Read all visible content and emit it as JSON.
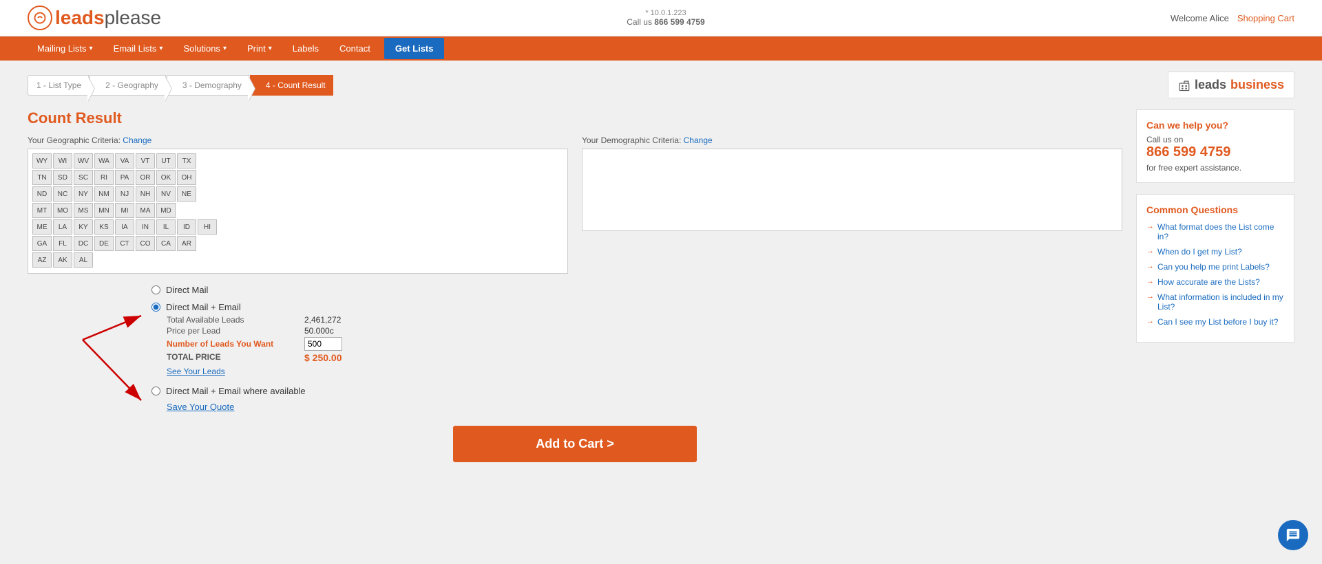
{
  "header": {
    "ip": "* 10.0.1.223",
    "call_label": "Call us",
    "phone": "866 599 4759",
    "welcome": "Welcome Alice",
    "shopping_cart": "Shopping Cart",
    "logo_leads": "leads",
    "logo_please": "please"
  },
  "nav": {
    "items": [
      {
        "label": "Mailing Lists",
        "dropdown": true
      },
      {
        "label": "Email Lists",
        "dropdown": true
      },
      {
        "label": "Solutions",
        "dropdown": true
      },
      {
        "label": "Print",
        "dropdown": true
      },
      {
        "label": "Labels",
        "dropdown": false
      },
      {
        "label": "Contact",
        "dropdown": false
      }
    ],
    "get_lists": "Get Lists"
  },
  "breadcrumb": {
    "steps": [
      {
        "label": "1 - List Type",
        "active": false
      },
      {
        "label": "2 - Geography",
        "active": false
      },
      {
        "label": "3 - Demography",
        "active": false
      },
      {
        "label": "4 - Count Result",
        "active": true
      }
    ]
  },
  "leads_business": {
    "icon": "🏢",
    "text_dark": "leads",
    "text_orange": "business"
  },
  "page_title": "Count Result",
  "geo_criteria": {
    "label": "Your Geographic Criteria:",
    "change_link": "Change"
  },
  "demo_criteria": {
    "label": "Your Demographic Criteria:",
    "change_link": "Change"
  },
  "states": [
    [
      "WY",
      "WI",
      "WV",
      "WA",
      "VA",
      "VT",
      "UT",
      "TX"
    ],
    [
      "TN",
      "SD",
      "SC",
      "RI",
      "PA",
      "OR",
      "OK",
      "OH"
    ],
    [
      "ND",
      "NC",
      "NY",
      "NM",
      "NJ",
      "NH",
      "NV",
      "NE"
    ],
    [
      "MT",
      "MO",
      "MS",
      "MN",
      "MI",
      "MA",
      "MD"
    ],
    [
      "ME",
      "LA",
      "KY",
      "KS",
      "IA",
      "IN",
      "IL",
      "ID",
      "HI"
    ],
    [
      "GA",
      "FL",
      "DC",
      "DE",
      "CT",
      "CO",
      "CA",
      "AR"
    ],
    [
      "AZ",
      "AK",
      "AL"
    ]
  ],
  "options": {
    "direct_mail": {
      "label": "Direct Mail",
      "selected": false
    },
    "direct_mail_email": {
      "label": "Direct Mail + Email",
      "selected": true,
      "details": {
        "total_leads_label": "Total Available Leads",
        "total_leads_value": "2,461,272",
        "price_per_lead_label": "Price per Lead",
        "price_per_lead_value": "50.000c",
        "num_leads_label": "Number of Leads You Want",
        "num_leads_value": "500",
        "total_price_label": "TOTAL PRICE",
        "total_price_value": "$ 250.00",
        "see_leads_link": "See Your Leads"
      }
    },
    "direct_mail_email_avail": {
      "label": "Direct Mail + Email where available",
      "selected": false
    }
  },
  "save_quote": "Save Your Quote",
  "add_to_cart": "Add to Cart >",
  "sidebar": {
    "help": {
      "title": "Can we help you?",
      "call_label": "Call us on",
      "phone": "866 599 4759",
      "subtitle": "for free expert assistance."
    },
    "faq": {
      "title": "Common Questions",
      "items": [
        "What format does the List come in?",
        "When do I get my List?",
        "Can you help me print Labels?",
        "How accurate are the Lists?",
        "What information is included in my List?",
        "Can I see my List before I buy it?"
      ]
    }
  },
  "chat": {
    "label": "Chat"
  }
}
